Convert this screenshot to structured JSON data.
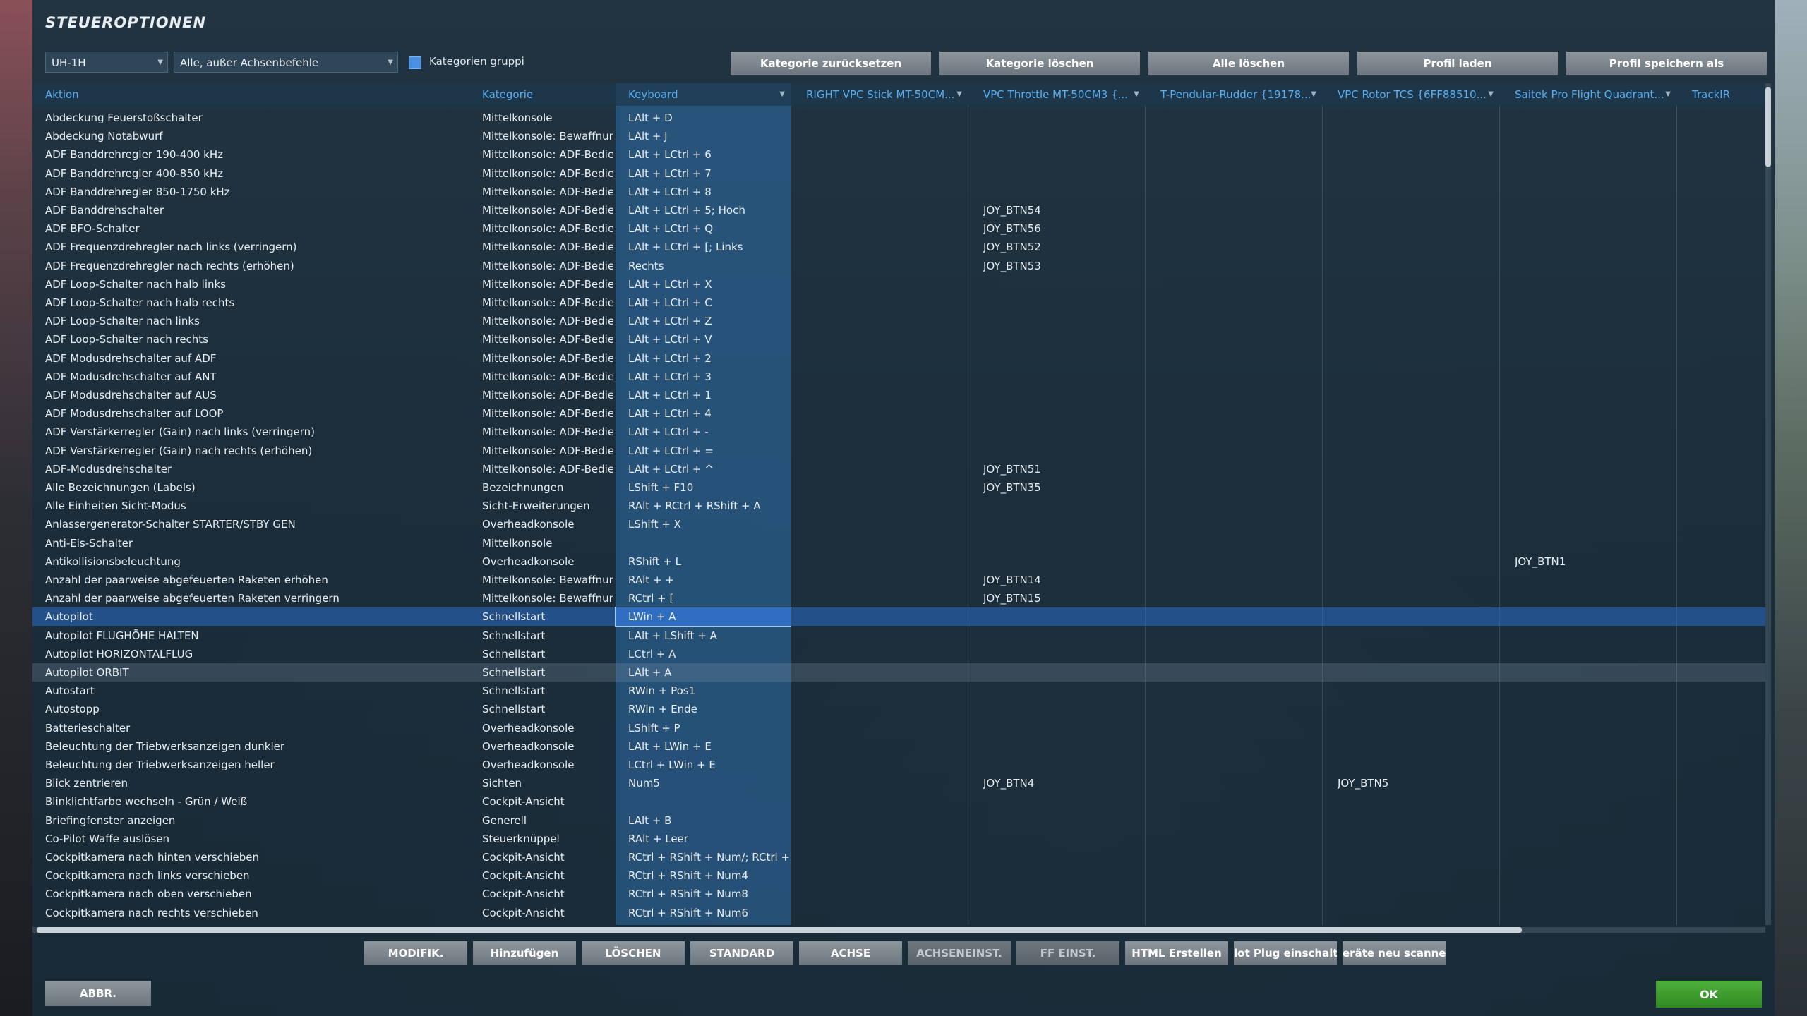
{
  "title": "STEUEROPTIONEN",
  "toolbar": {
    "aircraft": "UH-1H",
    "filter": "Alle, außer Achsenbefehle",
    "group_label": "Kategorien gruppi",
    "buttons": [
      "Kategorie zurücksetzen",
      "Kategorie löschen",
      "Alle löschen",
      "Profil laden",
      "Profil speichern als"
    ]
  },
  "columns": [
    "Aktion",
    "Kategorie",
    "Keyboard",
    "RIGHT VPC Stick MT-50CM...",
    "VPC Throttle MT-50CM3 {...",
    "T-Pendular-Rudder {19178...",
    "VPC Rotor TCS {6FF88510...",
    "Saitek Pro Flight Quadrant...",
    "TrackIR"
  ],
  "rows": [
    {
      "a": "Abdeckung Feuerstoßschalter",
      "c": "Mittelkonsole",
      "k": "LAlt + D",
      "s": "",
      "t": "",
      "r": "",
      "p": "",
      "q": "",
      "i": ""
    },
    {
      "a": "Abdeckung Notabwurf",
      "c": "Mittelkonsole: Bewaffnung",
      "k": "LAlt + J",
      "s": "",
      "t": "",
      "r": "",
      "p": "",
      "q": "",
      "i": ""
    },
    {
      "a": "ADF Banddrehregler 190-400 kHz",
      "c": "Mittelkonsole: ADF-Bedienteil",
      "k": "LAlt + LCtrl + 6",
      "s": "",
      "t": "",
      "r": "",
      "p": "",
      "q": "",
      "i": ""
    },
    {
      "a": "ADF Banddrehregler 400-850 kHz",
      "c": "Mittelkonsole: ADF-Bedienteil",
      "k": "LAlt + LCtrl + 7",
      "s": "",
      "t": "",
      "r": "",
      "p": "",
      "q": "",
      "i": ""
    },
    {
      "a": "ADF Banddrehregler 850-1750 kHz",
      "c": "Mittelkonsole: ADF-Bedienteil",
      "k": "LAlt + LCtrl + 8",
      "s": "",
      "t": "",
      "r": "",
      "p": "",
      "q": "",
      "i": ""
    },
    {
      "a": "ADF Banddrehschalter",
      "c": "Mittelkonsole: ADF-Bedienteil",
      "k": "LAlt + LCtrl + 5; Hoch",
      "s": "",
      "t": "JOY_BTN54",
      "r": "",
      "p": "",
      "q": "",
      "i": ""
    },
    {
      "a": "ADF BFO-Schalter",
      "c": "Mittelkonsole: ADF-Bedienteil",
      "k": "LAlt + LCtrl + Q",
      "s": "",
      "t": "JOY_BTN56",
      "r": "",
      "p": "",
      "q": "",
      "i": ""
    },
    {
      "a": "ADF Frequenzdrehregler nach links (verringern)",
      "c": "Mittelkonsole: ADF-Bedienteil",
      "k": "LAlt + LCtrl + [; Links",
      "s": "",
      "t": "JOY_BTN52",
      "r": "",
      "p": "",
      "q": "",
      "i": ""
    },
    {
      "a": "ADF Frequenzdrehregler nach rechts (erhöhen)",
      "c": "Mittelkonsole: ADF-Bedienteil",
      "k": "Rechts",
      "s": "",
      "t": "JOY_BTN53",
      "r": "",
      "p": "",
      "q": "",
      "i": ""
    },
    {
      "a": "ADF Loop-Schalter nach halb links",
      "c": "Mittelkonsole: ADF-Bedienteil",
      "k": "LAlt + LCtrl + X",
      "s": "",
      "t": "",
      "r": "",
      "p": "",
      "q": "",
      "i": ""
    },
    {
      "a": "ADF Loop-Schalter nach halb rechts",
      "c": "Mittelkonsole: ADF-Bedienteil",
      "k": "LAlt + LCtrl + C",
      "s": "",
      "t": "",
      "r": "",
      "p": "",
      "q": "",
      "i": ""
    },
    {
      "a": "ADF Loop-Schalter nach links",
      "c": "Mittelkonsole: ADF-Bedienteil",
      "k": "LAlt + LCtrl + Z",
      "s": "",
      "t": "",
      "r": "",
      "p": "",
      "q": "",
      "i": ""
    },
    {
      "a": "ADF Loop-Schalter nach rechts",
      "c": "Mittelkonsole: ADF-Bedienteil",
      "k": "LAlt + LCtrl + V",
      "s": "",
      "t": "",
      "r": "",
      "p": "",
      "q": "",
      "i": ""
    },
    {
      "a": "ADF Modusdrehschalter auf ADF",
      "c": "Mittelkonsole: ADF-Bedienteil",
      "k": "LAlt + LCtrl + 2",
      "s": "",
      "t": "",
      "r": "",
      "p": "",
      "q": "",
      "i": ""
    },
    {
      "a": "ADF Modusdrehschalter auf ANT",
      "c": "Mittelkonsole: ADF-Bedienteil",
      "k": "LAlt + LCtrl + 3",
      "s": "",
      "t": "",
      "r": "",
      "p": "",
      "q": "",
      "i": ""
    },
    {
      "a": "ADF Modusdrehschalter auf AUS",
      "c": "Mittelkonsole: ADF-Bedienteil",
      "k": "LAlt + LCtrl + 1",
      "s": "",
      "t": "",
      "r": "",
      "p": "",
      "q": "",
      "i": ""
    },
    {
      "a": "ADF Modusdrehschalter auf LOOP",
      "c": "Mittelkonsole: ADF-Bedienteil",
      "k": "LAlt + LCtrl + 4",
      "s": "",
      "t": "",
      "r": "",
      "p": "",
      "q": "",
      "i": ""
    },
    {
      "a": "ADF Verstärkerregler (Gain) nach links (verringern)",
      "c": "Mittelkonsole: ADF-Bedienteil",
      "k": "LAlt + LCtrl + -",
      "s": "",
      "t": "",
      "r": "",
      "p": "",
      "q": "",
      "i": ""
    },
    {
      "a": "ADF Verstärkerregler (Gain) nach rechts (erhöhen)",
      "c": "Mittelkonsole: ADF-Bedienteil",
      "k": "LAlt + LCtrl + =",
      "s": "",
      "t": "",
      "r": "",
      "p": "",
      "q": "",
      "i": ""
    },
    {
      "a": "ADF-Modusdrehschalter",
      "c": "Mittelkonsole: ADF-Bedienteil",
      "k": "LAlt + LCtrl + ^",
      "s": "",
      "t": "JOY_BTN51",
      "r": "",
      "p": "",
      "q": "",
      "i": ""
    },
    {
      "a": "Alle Bezeichnungen (Labels)",
      "c": "Bezeichnungen",
      "k": "LShift + F10",
      "s": "",
      "t": "JOY_BTN35",
      "r": "",
      "p": "",
      "q": "",
      "i": ""
    },
    {
      "a": "Alle Einheiten Sicht-Modus",
      "c": "Sicht-Erweiterungen",
      "k": "RAlt + RCtrl + RShift + A",
      "s": "",
      "t": "",
      "r": "",
      "p": "",
      "q": "",
      "i": ""
    },
    {
      "a": "Anlassergenerator-Schalter STARTER/STBY GEN",
      "c": "Overheadkonsole",
      "k": "LShift + X",
      "s": "",
      "t": "",
      "r": "",
      "p": "",
      "q": "",
      "i": ""
    },
    {
      "a": "Anti-Eis-Schalter",
      "c": "Mittelkonsole",
      "k": "",
      "s": "",
      "t": "",
      "r": "",
      "p": "",
      "q": "",
      "i": ""
    },
    {
      "a": "Antikollisionsbeleuchtung",
      "c": "Overheadkonsole",
      "k": "RShift + L",
      "s": "",
      "t": "",
      "r": "",
      "p": "",
      "q": "JOY_BTN1",
      "i": ""
    },
    {
      "a": "Anzahl der paarweise abgefeuerten Raketen erhöhen",
      "c": "Mittelkonsole: Bewaffnung",
      "k": "RAlt + +",
      "s": "",
      "t": "JOY_BTN14",
      "r": "",
      "p": "",
      "q": "",
      "i": ""
    },
    {
      "a": "Anzahl der paarweise abgefeuerten Raketen verringern",
      "c": "Mittelkonsole: Bewaffnung",
      "k": "RCtrl + [",
      "s": "",
      "t": "JOY_BTN15",
      "r": "",
      "p": "",
      "q": "",
      "i": ""
    },
    {
      "a": "Autopilot",
      "c": "Schnellstart",
      "k": "LWin + A",
      "s": "",
      "t": "",
      "r": "",
      "p": "",
      "q": "",
      "i": ""
    },
    {
      "a": "Autopilot FLUGHÖHE HALTEN",
      "c": "Schnellstart",
      "k": "LAlt + LShift + A",
      "s": "",
      "t": "",
      "r": "",
      "p": "",
      "q": "",
      "i": ""
    },
    {
      "a": "Autopilot HORIZONTALFLUG",
      "c": "Schnellstart",
      "k": "LCtrl + A",
      "s": "",
      "t": "",
      "r": "",
      "p": "",
      "q": "",
      "i": ""
    },
    {
      "a": "Autopilot ORBIT",
      "c": "Schnellstart",
      "k": "LAlt + A",
      "s": "",
      "t": "",
      "r": "",
      "p": "",
      "q": "",
      "i": ""
    },
    {
      "a": "Autostart",
      "c": "Schnellstart",
      "k": "RWin + Pos1",
      "s": "",
      "t": "",
      "r": "",
      "p": "",
      "q": "",
      "i": ""
    },
    {
      "a": "Autostopp",
      "c": "Schnellstart",
      "k": "RWin + Ende",
      "s": "",
      "t": "",
      "r": "",
      "p": "",
      "q": "",
      "i": ""
    },
    {
      "a": "Batterieschalter",
      "c": "Overheadkonsole",
      "k": "LShift + P",
      "s": "",
      "t": "",
      "r": "",
      "p": "",
      "q": "",
      "i": ""
    },
    {
      "a": "Beleuchtung der Triebwerksanzeigen dunkler",
      "c": "Overheadkonsole",
      "k": "LAlt + LWin + E",
      "s": "",
      "t": "",
      "r": "",
      "p": "",
      "q": "",
      "i": ""
    },
    {
      "a": "Beleuchtung der Triebwerksanzeigen heller",
      "c": "Overheadkonsole",
      "k": "LCtrl + LWin + E",
      "s": "",
      "t": "",
      "r": "",
      "p": "",
      "q": "",
      "i": ""
    },
    {
      "a": "Blick zentrieren",
      "c": "Sichten",
      "k": "Num5",
      "s": "",
      "t": "JOY_BTN4",
      "r": "",
      "p": "JOY_BTN5",
      "q": "",
      "i": ""
    },
    {
      "a": "Blinklichtfarbe wechseln - Grün / Weiß",
      "c": "Cockpit-Ansicht",
      "k": "",
      "s": "",
      "t": "",
      "r": "",
      "p": "",
      "q": "",
      "i": ""
    },
    {
      "a": "Briefingfenster anzeigen",
      "c": "Generell",
      "k": "LAlt + B",
      "s": "",
      "t": "",
      "r": "",
      "p": "",
      "q": "",
      "i": ""
    },
    {
      "a": "Co-Pilot Waffe auslösen",
      "c": "Steuerknüppel",
      "k": "RAlt + Leer",
      "s": "",
      "t": "",
      "r": "",
      "p": "",
      "q": "",
      "i": ""
    },
    {
      "a": "Cockpitkamera nach hinten verschieben",
      "c": "Cockpit-Ansicht",
      "k": "RCtrl + RShift + Num/; RCtrl + RShift",
      "s": "",
      "t": "",
      "r": "",
      "p": "",
      "q": "",
      "i": ""
    },
    {
      "a": "Cockpitkamera nach links verschieben",
      "c": "Cockpit-Ansicht",
      "k": "RCtrl + RShift + Num4",
      "s": "",
      "t": "",
      "r": "",
      "p": "",
      "q": "",
      "i": ""
    },
    {
      "a": "Cockpitkamera nach oben verschieben",
      "c": "Cockpit-Ansicht",
      "k": "RCtrl + RShift + Num8",
      "s": "",
      "t": "",
      "r": "",
      "p": "",
      "q": "",
      "i": ""
    },
    {
      "a": "Cockpitkamera nach rechts verschieben",
      "c": "Cockpit-Ansicht",
      "k": "RCtrl + RShift + Num6",
      "s": "",
      "t": "",
      "r": "",
      "p": "",
      "q": "",
      "i": ""
    }
  ],
  "selected_row": 27,
  "highlighted_row": 30,
  "bottom_buttons": [
    "MODIFIK.",
    "Hinzufügen",
    "LÖSCHEN",
    "STANDARD",
    "ACHSE",
    "ACHSENEINST.",
    "FF EINST.",
    "HTML Erstellen",
    "lot Plug einschalte",
    "eräte neu scanne"
  ],
  "disabled_bottom": [
    5,
    6
  ],
  "cancel_label": "ABBR.",
  "ok_label": "OK",
  "colors": {
    "ok": "#3a9a2c",
    "selection": "#2f6ec0",
    "header_text": "#5aaef0"
  }
}
